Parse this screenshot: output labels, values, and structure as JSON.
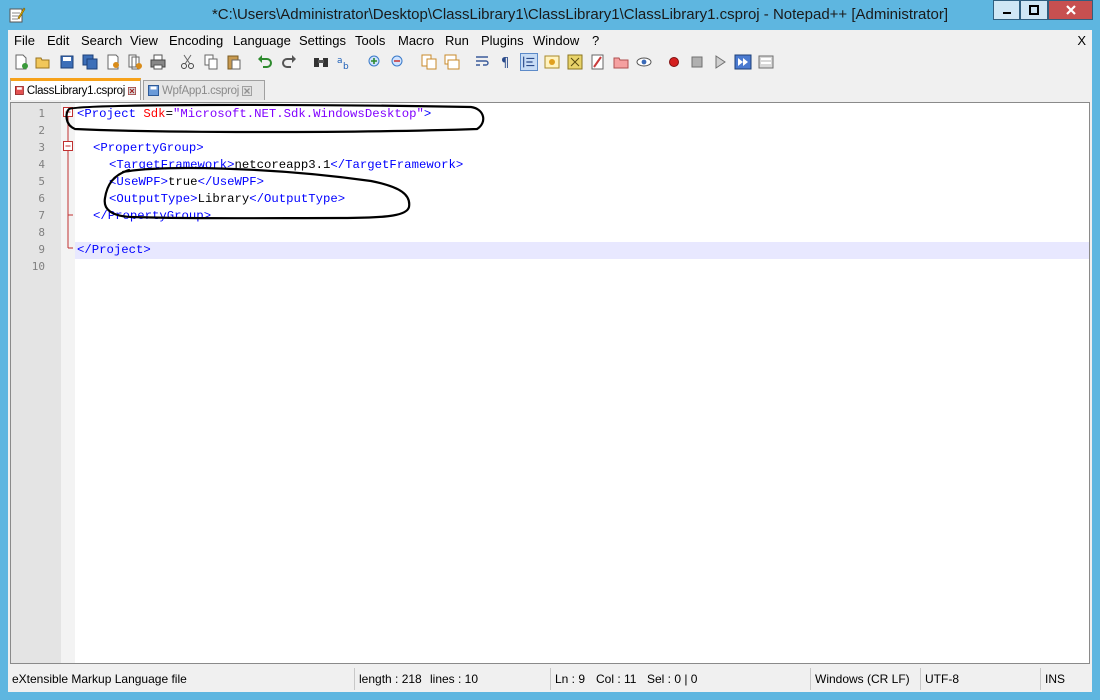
{
  "title": "*C:\\Users\\Administrator\\Desktop\\ClassLibrary1\\ClassLibrary1\\ClassLibrary1.csproj - Notepad++ [Administrator]",
  "menu": [
    "File",
    "Edit",
    "Search",
    "View",
    "Encoding",
    "Language",
    "Settings",
    "Tools",
    "Macro",
    "Run",
    "Plugins",
    "Window",
    "?"
  ],
  "menu_close": "X",
  "tabs": [
    {
      "label": "ClassLibrary1.csproj",
      "active": true
    },
    {
      "label": "WpfApp1.csproj",
      "active": false
    }
  ],
  "line_numbers": [
    "1",
    "2",
    "3",
    "4",
    "5",
    "6",
    "7",
    "8",
    "9",
    "10"
  ],
  "code": {
    "l1_open": "<Project ",
    "l1_attr": "Sdk",
    "l1_eq": "=",
    "l1_val": "\"Microsoft.NET.Sdk.WindowsDesktop\"",
    "l1_close": ">",
    "l3": "<PropertyGroup>",
    "l4_open": "<TargetFramework>",
    "l4_text": "netcoreapp3.1",
    "l4_close": "</TargetFramework>",
    "l5_open": "<UseWPF>",
    "l5_text": "true",
    "l5_close": "</UseWPF>",
    "l6_open": "<OutputType>",
    "l6_text": "Library",
    "l6_close": "</OutputType>",
    "l7": "</PropertyGroup>",
    "l9": "</Project>"
  },
  "status": {
    "filetype": "eXtensible Markup Language file",
    "length": "length : 218",
    "lines": "lines : 10",
    "ln": "Ln : 9",
    "col": "Col : 11",
    "sel": "Sel : 0 | 0",
    "eol": "Windows (CR LF)",
    "encoding": "UTF-8",
    "mode": "INS"
  },
  "colors": {
    "tag": "#0000ff",
    "attr": "#ff0000",
    "value": "#8000ff",
    "current_line": "#e8e8ff",
    "title_bar": "#5eb6e0"
  }
}
